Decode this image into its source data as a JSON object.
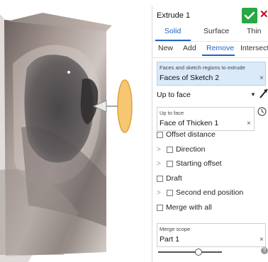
{
  "dialog": {
    "title": "Extrude 1",
    "body_tabs": [
      "Solid",
      "Surface",
      "Thin"
    ],
    "op_tabs": [
      "New",
      "Add",
      "Remove",
      "Intersect"
    ],
    "selection_label": "Faces and sketch regions to extrude",
    "selection_value": "Faces of Sketch 2",
    "end_type": "Up to face",
    "up_to_face_label": "Up to face",
    "up_to_face_value": "Face of Thicken 1",
    "options": {
      "offset_distance": "Offset distance",
      "direction": "Direction",
      "starting_offset": "Starting offset",
      "draft": "Draft",
      "second_end": "Second end position",
      "merge_all": "Merge with all"
    },
    "merge_scope_label": "Merge scope",
    "merge_scope_value": "Part 1",
    "slider_value": 0.62
  },
  "colors": {
    "accent": "#1f63c6",
    "ok_green": "#28a745",
    "close_red": "#d0021b",
    "selection_bg": "#dbeaf9",
    "disk_orange": "#f5c56a"
  },
  "icons": {
    "ok": "check-icon",
    "close": "close-icon",
    "flip": "flip-direction-icon",
    "clock": "clock-icon",
    "info": "info-icon"
  }
}
